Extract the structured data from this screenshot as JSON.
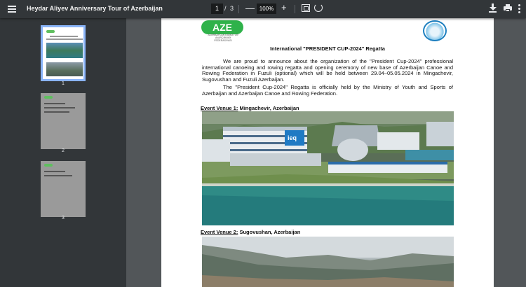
{
  "toolbar": {
    "title": "Heydar Aliyev Anniversary Tour of Azerbaijan",
    "current_page": "1",
    "separator": "/",
    "total_pages": "3",
    "zoom_minus": "—",
    "zoom": "100%",
    "zoom_plus": "+",
    "icons": [
      "menu-icon",
      "fit-page-icon",
      "rotate-icon",
      "download-icon",
      "print-icon",
      "more-icon"
    ]
  },
  "sidebar": {
    "thumbnails": [
      {
        "label": "1",
        "active": true
      },
      {
        "label": "2",
        "active": false
      },
      {
        "label": "3",
        "active": false
      }
    ]
  },
  "document": {
    "logo_left_text": "AZE",
    "logo_left_sub": "AZƏRBAYCAN KANOE VƏ AVARÇƏKMƏ FEDERASİYASI",
    "heading": "International \"PRESIDENT CUP-2024\" Regatta",
    "para1": "We are proud to announce about the organization of the \"President Cup-2024\" professional international canoeing and rowing regatta and opening ceremony of new base of Azerbaijan Canoe and Rowing Federation in Fuzuli (optional) which will be held between 29.04–05.05.2024 in Mingachevir, Sugovushan and Fuzuli Azerbaijan.",
    "para2": "The \"President Cup-2024\" Regatta is officially held by the Ministry of Youth and Sports of Azerbaijan and Azerbaijan Canoe and Rowing Federation.",
    "venue1_label": "Event Venue 1:",
    "venue1_name": "Mingachevir, Azerbaijan",
    "venue2_label": "Event Venue 2:",
    "venue2_name": "Sugovushan, Azerbaijan",
    "photo_sign_text": "ieq"
  }
}
